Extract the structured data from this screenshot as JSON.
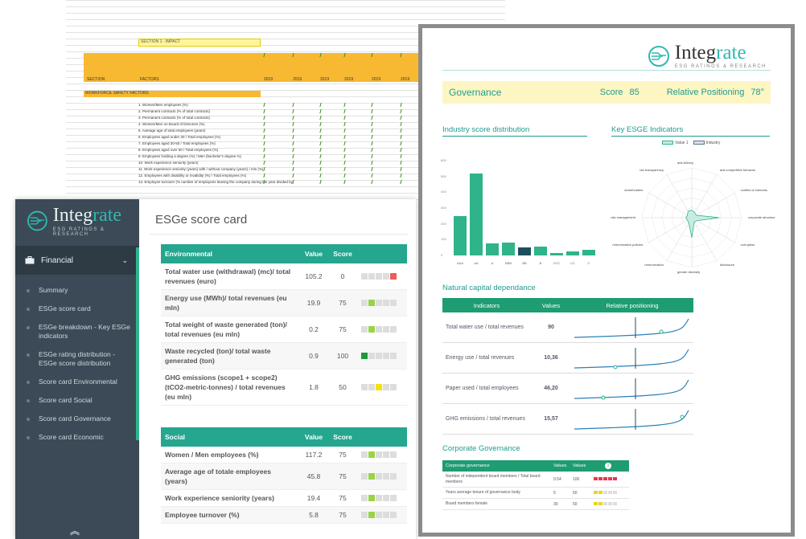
{
  "sheet": {
    "section_label": "SECTION 1 - IMPACT",
    "col_section": "SECTION",
    "col_factors": "FACTORS",
    "year_headers": [
      "2019",
      "2019",
      "2019",
      "2019",
      "2019",
      "2019"
    ],
    "subsection": "WORKFORCE SAFETY FACTORS",
    "rows": [
      "1. Women/Men employees (%)",
      "2. Permanent contracts (% of total contracts)",
      "3. Permanent contracts (% of total contracts)",
      "4. Women/Men on Board of Directors (%)",
      "5. Average age of total employees (years)",
      "6. Employees aged under 30 / Total employees (%)",
      "7. Employees aged 30-50 / Total employees (%)",
      "8. Employees aged over 50 / Total employees (%)",
      "9. Employees holding a degree (%) / Men (bachelor's degree %)",
      "10. Work experience seniority (years)",
      "11. Work experience seniority (years) with / without company (years) / mln (%)",
      "12. Employees with disability or invalidity (%) / Total employees (%)",
      "13. Employee turnover (% number of employees leaving the company during the year divided by"
    ]
  },
  "report": {
    "brand_pre": "Integ",
    "brand_post": "rate",
    "brand_sub": "ESG RATINGS & RESEARCH",
    "gov_title": "Governance",
    "score_label": "Score",
    "score_value": "85",
    "rel_label": "Relative Positioning",
    "rel_value": "78°",
    "dist_title": "Industry score distribution",
    "kpi_title": "Key ESGE Indicators",
    "legend_value": "Value 1",
    "legend_industry": "Industry",
    "radar_labels": [
      "anti-bribery",
      "anti competitive behavior",
      "conflict of interests",
      "corporate structure",
      "corruption",
      "disclosure",
      "gender diversity",
      "remuneration",
      "remuneration policies",
      "risk management",
      "shareholders",
      "tax transparency"
    ],
    "nat_title": "Natural capital dependance",
    "nat_headers": [
      "Indicators",
      "Values",
      "Relative positioning"
    ],
    "nat_rows": [
      {
        "label": "Total water use / total revenues",
        "value": "90"
      },
      {
        "label": "Energy use / total revenues",
        "value": "10,36"
      },
      {
        "label": "Paper used / total employees",
        "value": "46,20"
      },
      {
        "label": "GHG emissions / total revenues",
        "value": "15,57"
      }
    ],
    "cg_title": "Corporate Governance",
    "cg_headers": [
      "Corporate governance",
      "Values",
      "Values"
    ],
    "cg_rows": [
      {
        "label": "Number of independent board members / Total board members",
        "v1": "0.54",
        "v2": "100"
      },
      {
        "label": "Years average tenure of governance body",
        "v1": "5",
        "v2": "50"
      },
      {
        "label": "Board members female",
        "v1": "30",
        "v2": "50"
      }
    ]
  },
  "chart_data": {
    "type": "bar",
    "categories": [
      "AAA",
      "AA",
      "A",
      "BBB",
      "BB",
      "B",
      "CCC",
      "CC",
      "C"
    ],
    "values": [
      250,
      520,
      75,
      80,
      50,
      55,
      15,
      25,
      35
    ],
    "ylim": [
      0,
      600
    ],
    "yticks": [
      "0",
      "100",
      "200",
      "300",
      "400",
      "500",
      "600"
    ]
  },
  "app": {
    "brand_pre": "Integ",
    "brand_post": "rate",
    "brand_sub": "ESG RATINGS & RESEARCH",
    "menu_group": "Financial",
    "nav": [
      "Summary",
      "ESGe score card",
      "ESGe breakdown - Key ESGe indicators",
      "ESGe rating distribution - ESGe score distribution",
      "Score card Environmental",
      "Score card Social",
      "Score card Governance",
      "Score card Economic"
    ],
    "page_title": "ESGe score card",
    "env": {
      "header": "Environmental",
      "col_value": "Value",
      "col_score": "Score",
      "rows": [
        {
          "label": "Total water use (withdrawal) (mc)/ total revenues (euro)",
          "value": "105.2",
          "score": "0"
        },
        {
          "label": "Energy use (MWh)/ total revenues (eu mln)",
          "value": "19.9",
          "score": "75"
        },
        {
          "label": "Total weight of waste generated (ton)/ total revenues (eu mln)",
          "value": "0.2",
          "score": "75"
        },
        {
          "label": "Waste recycled (ton)/ total waste generated (ton)",
          "value": "0.9",
          "score": "100"
        },
        {
          "label": "GHG emissions (scope1 + scope2) (tCO2-metric-tonnes) / total revenues (eu mln)",
          "value": "1.8",
          "score": "50"
        }
      ]
    },
    "social": {
      "header": "Social",
      "col_value": "Value",
      "col_score": "Score",
      "rows": [
        {
          "label": "Women / Men employees (%)",
          "value": "117.2",
          "score": "75"
        },
        {
          "label": "Average age of totale employees (years)",
          "value": "45.8",
          "score": "75"
        },
        {
          "label": "Work experience seniority (years)",
          "value": "19.4",
          "score": "75"
        },
        {
          "label": "Employee turnover (%)",
          "value": "5.8",
          "score": "75"
        }
      ]
    }
  },
  "colors": {
    "teal": "#25a68f",
    "sidebar": "#3b4a56",
    "red": "#f05a5a",
    "green_dark": "#1a9a3a",
    "green_light": "#9ad34a",
    "yellow": "#f3e20b"
  }
}
